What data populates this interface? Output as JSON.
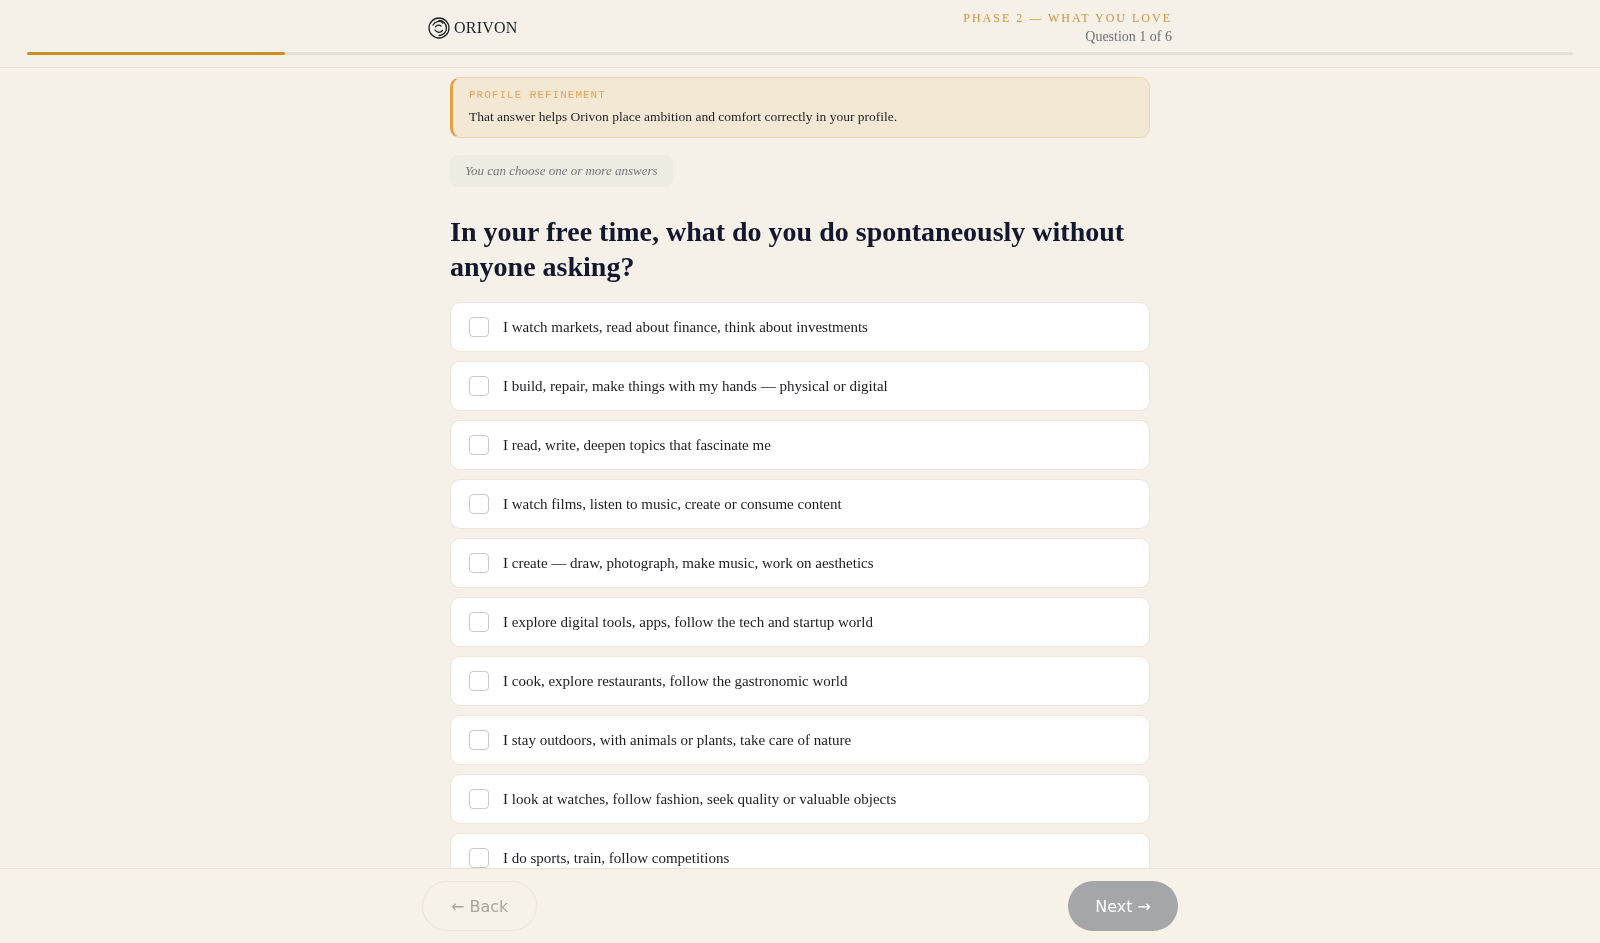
{
  "header": {
    "logo": "ORIVON",
    "phase": "PHASE 2 — WHAT YOU LOVE",
    "question_counter": "Question 1 of 6",
    "progress": {
      "level": 0.167
    }
  },
  "refinement": {
    "label": "PROFILE REFINEMENT",
    "text": "That answer helps Orivon place ambition and comfort correctly in your profile."
  },
  "hint": "You can choose one or more answers",
  "question": "In your free time, what do you do spontaneously without anyone asking?",
  "options": [
    {
      "label": "I watch markets, read about finance, think about investments",
      "checked": false
    },
    {
      "label": "I build, repair, make things with my hands — physical or digital",
      "checked": false
    },
    {
      "label": "I read, write, deepen topics that fascinate me",
      "checked": false
    },
    {
      "label": "I watch films, listen to music, create or consume content",
      "checked": false
    },
    {
      "label": "I create — draw, photograph, make music, work on aesthetics",
      "checked": false
    },
    {
      "label": "I explore digital tools, apps, follow the tech and startup world",
      "checked": false
    },
    {
      "label": "I cook, explore restaurants, follow the gastronomic world",
      "checked": false
    },
    {
      "label": "I stay outdoors, with animals or plants, take care of nature",
      "checked": false
    },
    {
      "label": "I look at watches, follow fashion, seek quality or valuable objects",
      "checked": false
    },
    {
      "label": "I do sports, train, follow competitions",
      "checked": false
    }
  ],
  "footer": {
    "back": {
      "label": "← Back",
      "disabled": true
    },
    "next": {
      "label": "Next →",
      "disabled": true
    }
  }
}
